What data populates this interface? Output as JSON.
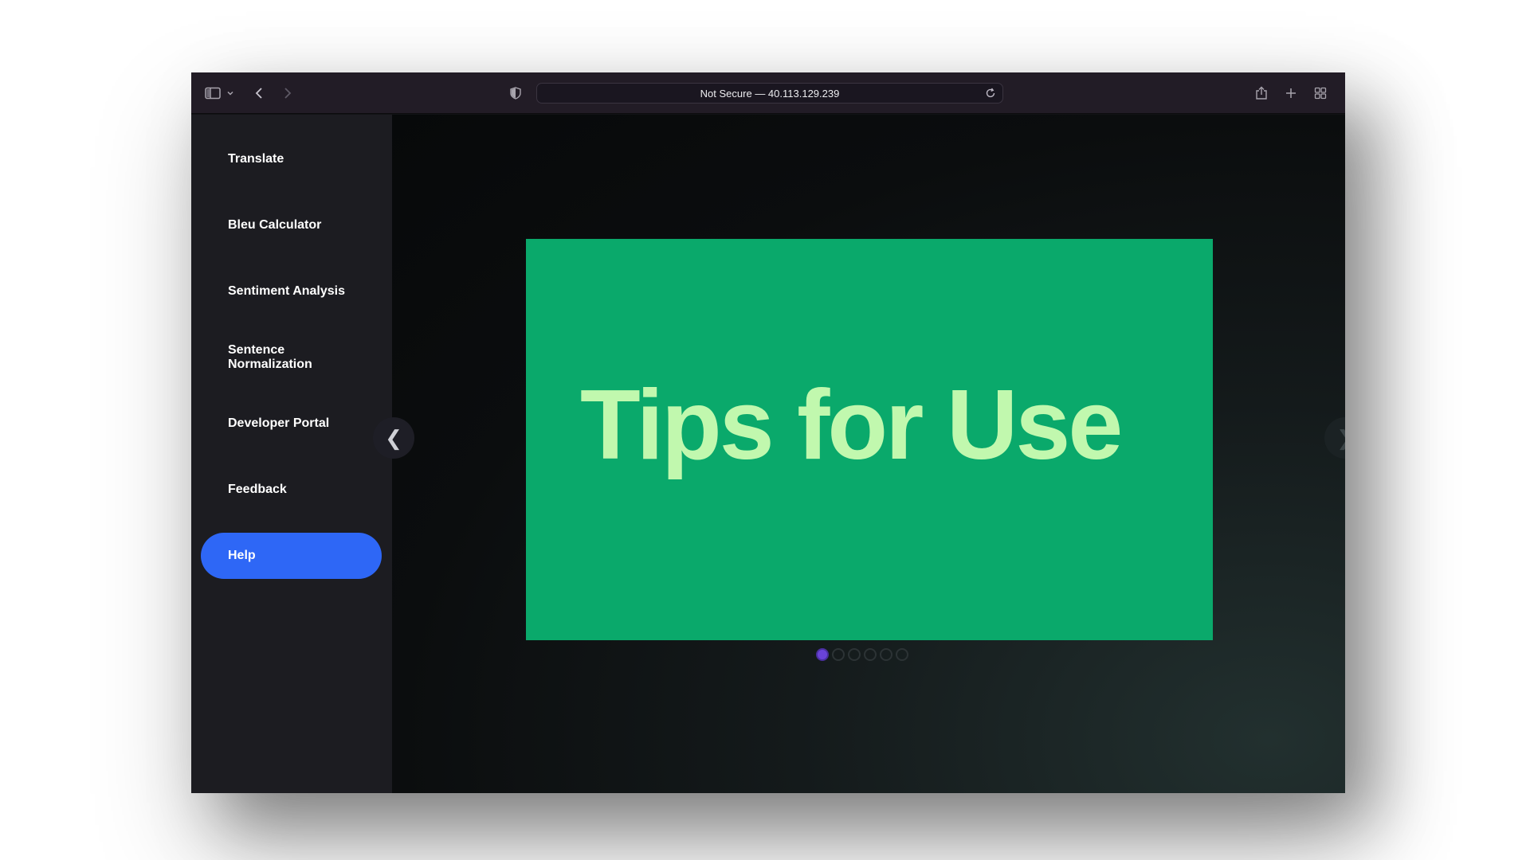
{
  "browser": {
    "url_text": "Not Secure — 40.113.129.239",
    "icons": {
      "sidebar_toggle": "sidebar-icon",
      "dropdown": "chevron-down-icon",
      "back": "chevron-left-icon",
      "forward": "chevron-right-icon",
      "privacy": "shield-icon",
      "reload": "reload-icon",
      "share": "share-icon",
      "new_tab": "plus-icon",
      "tab_overview": "grid-icon"
    }
  },
  "sidebar": {
    "items": [
      {
        "label": "Translate",
        "active": false
      },
      {
        "label": "Bleu Calculator",
        "active": false
      },
      {
        "label": "Sentiment Analysis",
        "active": false
      },
      {
        "label": "Sentence Normalization",
        "active": false
      },
      {
        "label": "Developer Portal",
        "active": false
      },
      {
        "label": "Feedback",
        "active": false
      },
      {
        "label": "Help",
        "active": true
      }
    ]
  },
  "carousel": {
    "slide_text": "Tips for Use",
    "prev_glyph": "❮",
    "next_glyph": "❯",
    "dot_count": 6,
    "active_dot": 0
  },
  "colors": {
    "accent": "#2e67f6",
    "slide_bg": "#0aa96b",
    "slide_text": "#c1f8ae",
    "active_dot": "#6a43d8"
  }
}
